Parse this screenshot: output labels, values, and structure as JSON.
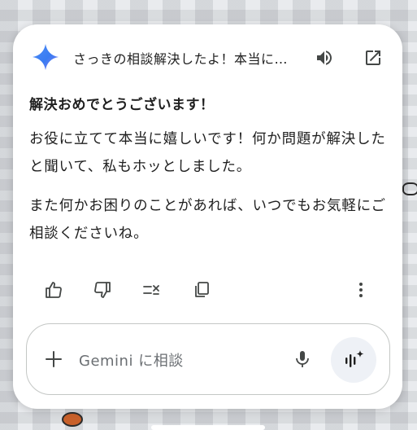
{
  "header": {
    "title": "さっきの相談解決したよ！本当に助かったよ！ありがとう",
    "speaker_icon": "speaker-icon",
    "open_icon": "open-in-new-icon"
  },
  "response": {
    "greeting": "解決おめでとうございます！",
    "paragraph_1": "お役に立てて本当に嬉しいです！何か問題が解決したと聞いて、私もホッとしました。",
    "paragraph_2": "また何かお困りのことがあれば、いつでもお気軽にご相談くださいね。"
  },
  "actions": [
    "thumbs-up-icon",
    "thumbs-down-icon",
    "modify-response-icon",
    "copy-icon",
    "more-vert-icon"
  ],
  "input": {
    "placeholder": "Gemini に相談",
    "plus_icon": "plus-icon",
    "mic_icon": "mic-icon",
    "live_icon": "gemini-live-icon"
  },
  "colors": {
    "accent_blue": "#4285f4",
    "text": "#1f1f1f",
    "placeholder": "#6b6f73"
  }
}
